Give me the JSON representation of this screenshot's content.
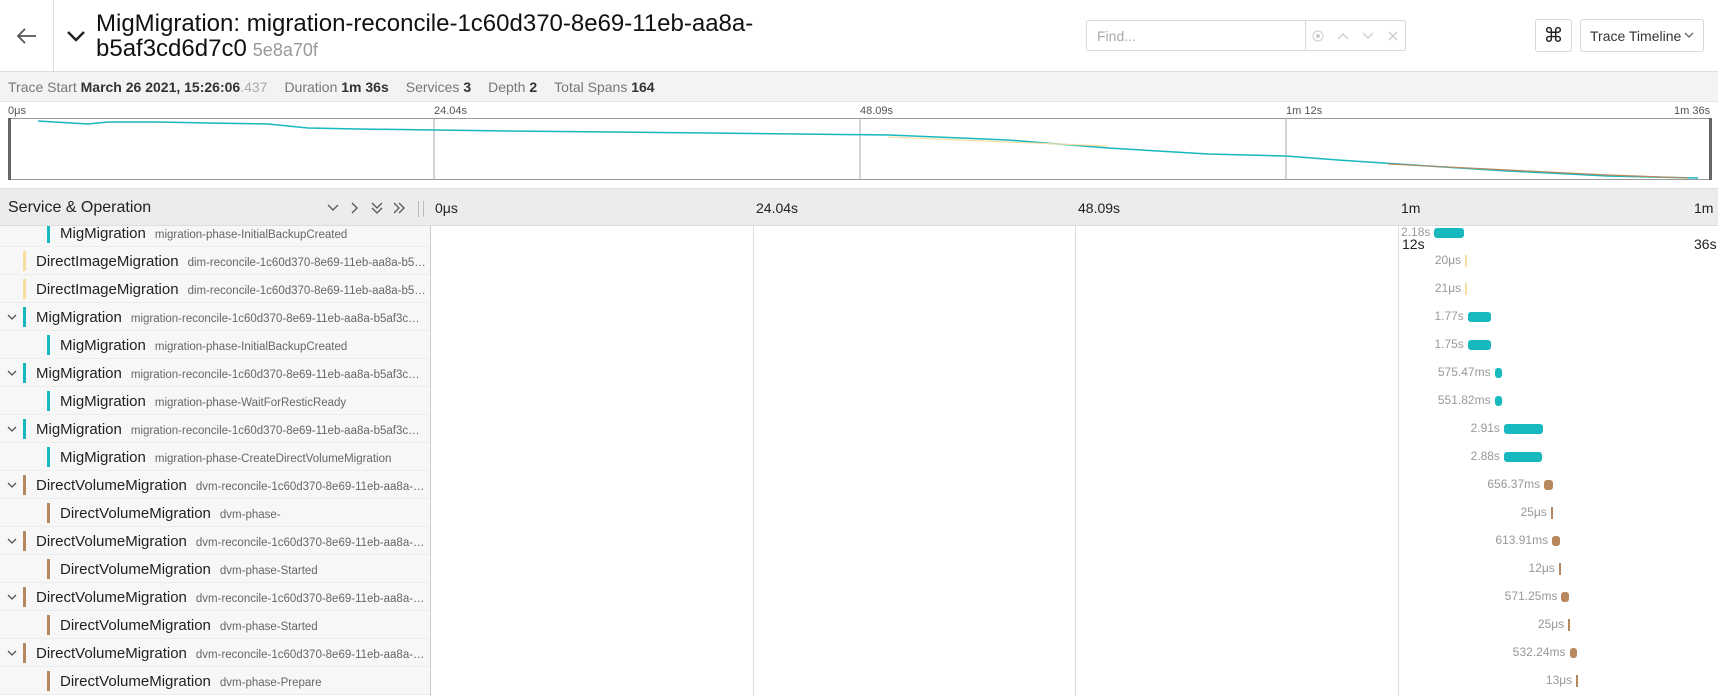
{
  "colors": {
    "teal": "#17b8be",
    "tan": "#f8dca1",
    "brown": "#b7885e"
  },
  "header": {
    "title": "MigMigration: migration-reconcile-1c60d370-8e69-11eb-aa8a-b5af3cd6d7c0",
    "trace_id": "5e8a70f",
    "find_placeholder": "Find...",
    "keyboard_glyph": "⌘",
    "view_label": "Trace Timeline"
  },
  "summary": {
    "trace_start_label": "Trace Start",
    "trace_start_value": "March 26 2021, 15:26:06",
    "trace_start_ms": ".437",
    "duration_label": "Duration",
    "duration_value": "1m 36s",
    "services_label": "Services",
    "services_value": "3",
    "depth_label": "Depth",
    "depth_value": "2",
    "total_spans_label": "Total Spans",
    "total_spans_value": "164"
  },
  "minimap": {
    "ticks": [
      "0μs",
      "24.04s",
      "48.09s",
      "1m 12s",
      "1m 36s"
    ]
  },
  "timeline": {
    "column_title": "Service & Operation",
    "ticks": [
      "0μs",
      "24.04s",
      "48.09s",
      "1m",
      "1m"
    ],
    "tick_overflow": [
      "12s",
      "36s"
    ]
  },
  "rows": [
    {
      "service": "MigMigration",
      "operation": "migration-phase-InitialBackupCreated",
      "duration": "2.18s",
      "start_s": 75.0,
      "dur_s": 2.18,
      "color": "teal",
      "depth": 1,
      "toggle": false
    },
    {
      "service": "DirectImageMigration",
      "operation": "dim-reconcile-1c60d370-8e69-11eb-aa8a-b5…",
      "duration": "20μs",
      "start_s": 77.3,
      "dur_s": 2e-05,
      "color": "tan",
      "depth": 0,
      "toggle": false
    },
    {
      "service": "DirectImageMigration",
      "operation": "dim-reconcile-1c60d370-8e69-11eb-aa8a-b5…",
      "duration": "21μs",
      "start_s": 77.3,
      "dur_s": 2e-05,
      "color": "tan",
      "depth": 0,
      "toggle": false
    },
    {
      "service": "MigMigration",
      "operation": "migration-reconcile-1c60d370-8e69-11eb-aa8a-b5af3c…",
      "duration": "1.77s",
      "start_s": 77.5,
      "dur_s": 1.77,
      "color": "teal",
      "depth": 0,
      "toggle": true
    },
    {
      "service": "MigMigration",
      "operation": "migration-phase-InitialBackupCreated",
      "duration": "1.75s",
      "start_s": 77.5,
      "dur_s": 1.75,
      "color": "teal",
      "depth": 1,
      "toggle": false
    },
    {
      "service": "MigMigration",
      "operation": "migration-reconcile-1c60d370-8e69-11eb-aa8a-b5af3c…",
      "duration": "575.47ms",
      "start_s": 79.5,
      "dur_s": 0.575,
      "color": "teal",
      "depth": 0,
      "toggle": true
    },
    {
      "service": "MigMigration",
      "operation": "migration-phase-WaitForResticReady",
      "duration": "551.82ms",
      "start_s": 79.5,
      "dur_s": 0.552,
      "color": "teal",
      "depth": 1,
      "toggle": false
    },
    {
      "service": "MigMigration",
      "operation": "migration-reconcile-1c60d370-8e69-11eb-aa8a-b5af3c…",
      "duration": "2.91s",
      "start_s": 80.2,
      "dur_s": 2.91,
      "color": "teal",
      "depth": 0,
      "toggle": true
    },
    {
      "service": "MigMigration",
      "operation": "migration-phase-CreateDirectVolumeMigration",
      "duration": "2.88s",
      "start_s": 80.2,
      "dur_s": 2.88,
      "color": "teal",
      "depth": 1,
      "toggle": false
    },
    {
      "service": "DirectVolumeMigration",
      "operation": "dvm-reconcile-1c60d370-8e69-11eb-aa8a-…",
      "duration": "656.37ms",
      "start_s": 83.2,
      "dur_s": 0.656,
      "color": "brown",
      "depth": 0,
      "toggle": true
    },
    {
      "service": "DirectVolumeMigration",
      "operation": "dvm-phase-",
      "duration": "25μs",
      "start_s": 83.7,
      "dur_s": 3e-05,
      "color": "brown",
      "depth": 1,
      "toggle": false
    },
    {
      "service": "DirectVolumeMigration",
      "operation": "dvm-reconcile-1c60d370-8e69-11eb-aa8a-…",
      "duration": "613.91ms",
      "start_s": 83.8,
      "dur_s": 0.614,
      "color": "brown",
      "depth": 0,
      "toggle": true
    },
    {
      "service": "DirectVolumeMigration",
      "operation": "dvm-phase-Started",
      "duration": "12μs",
      "start_s": 84.3,
      "dur_s": 1e-05,
      "color": "brown",
      "depth": 1,
      "toggle": false
    },
    {
      "service": "DirectVolumeMigration",
      "operation": "dvm-reconcile-1c60d370-8e69-11eb-aa8a-…",
      "duration": "571.25ms",
      "start_s": 84.5,
      "dur_s": 0.571,
      "color": "brown",
      "depth": 0,
      "toggle": true
    },
    {
      "service": "DirectVolumeMigration",
      "operation": "dvm-phase-Started",
      "duration": "25μs",
      "start_s": 85.0,
      "dur_s": 3e-05,
      "color": "brown",
      "depth": 1,
      "toggle": false
    },
    {
      "service": "DirectVolumeMigration",
      "operation": "dvm-reconcile-1c60d370-8e69-11eb-aa8a-…",
      "duration": "532.24ms",
      "start_s": 85.1,
      "dur_s": 0.532,
      "color": "brown",
      "depth": 0,
      "toggle": true
    },
    {
      "service": "DirectVolumeMigration",
      "operation": "dvm-phase-Prepare",
      "duration": "13μs",
      "start_s": 85.6,
      "dur_s": 1e-05,
      "color": "brown",
      "depth": 1,
      "toggle": false
    }
  ]
}
